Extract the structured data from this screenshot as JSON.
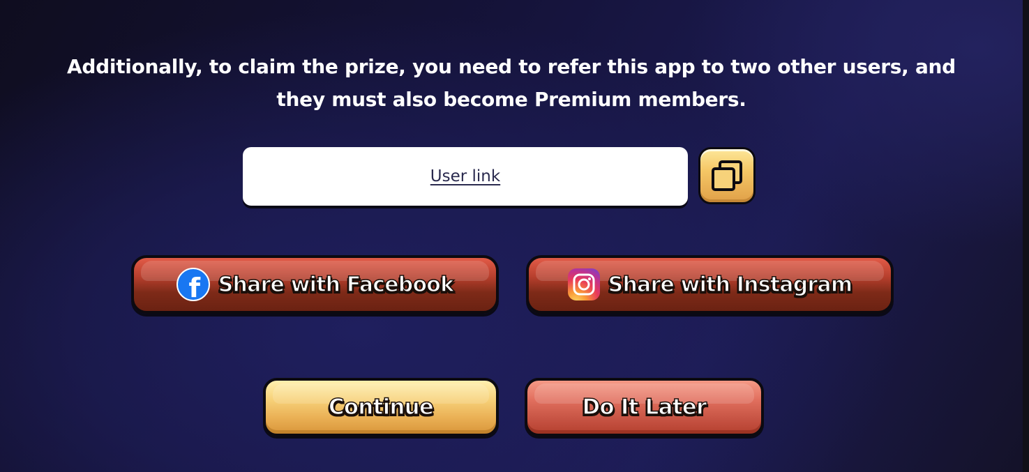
{
  "colors": {
    "background": "#15133a",
    "share_button": "#b8402e",
    "continue_button": "#f7d27a",
    "later_button": "#e2705f",
    "link_text": "#2a2a4e"
  },
  "message": {
    "line1": "Additionally, to claim the prize, you need to refer this app to two other users, and",
    "line2": "they must also become Premium members."
  },
  "referral": {
    "link_label": "User link",
    "copy_icon": "copy-icon"
  },
  "share": {
    "facebook": {
      "label": "Share with Facebook",
      "icon": "facebook-icon"
    },
    "instagram": {
      "label": "Share with Instagram",
      "icon": "instagram-icon"
    }
  },
  "actions": {
    "continue_label": "Continue",
    "later_label": "Do It Later"
  }
}
